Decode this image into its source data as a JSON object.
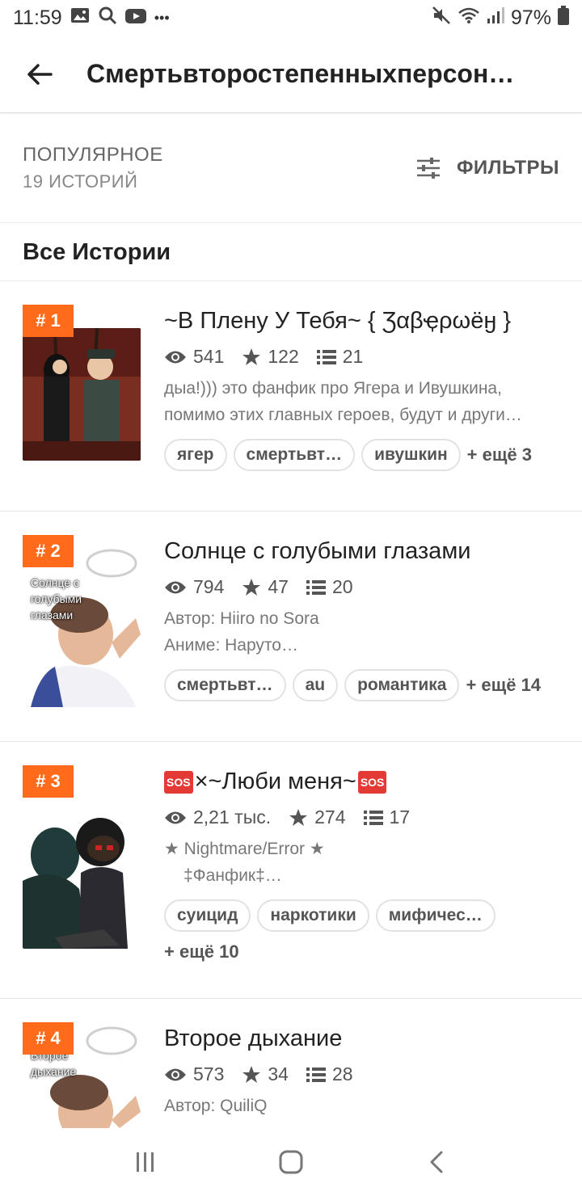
{
  "status_bar": {
    "time": "11:59",
    "overflow": "•••",
    "battery": "97%"
  },
  "header": {
    "title": "Смертьвторостепенныхперсон…"
  },
  "filter": {
    "sort": "ПОПУЛЯРНОЕ",
    "count": "19 ИСТОРИЙ",
    "filters_label": "ФИЛЬТРЫ"
  },
  "section": {
    "title": "Все Истории"
  },
  "stories": [
    {
      "rank": "# 1",
      "title": "~В Плену У Тебя~ { Ʒαβҿρωёӈ }",
      "views": "541",
      "votes": "122",
      "parts": "21",
      "desc1": "дыа!))) это фанфик про Ягера и Ивушкина,",
      "desc2": "помимо этих главных героев, будут и други…",
      "tags": [
        "ягер",
        "смертьвт…",
        "ивушкин"
      ],
      "more": "+ ещё 3"
    },
    {
      "rank": "# 2",
      "title": "Солнце с голубыми глазами",
      "cover_text": "Солнце с голубыми глазами",
      "views": "794",
      "votes": "47",
      "parts": "20",
      "desc1": "Автор: Hiiro no Sora",
      "desc2": "Аниме: Наруто…",
      "tags": [
        "смертьвт…",
        "au",
        "романтика"
      ],
      "more": "+ ещё 14"
    },
    {
      "rank": "# 3",
      "title_prefix_icon": "SOS",
      "title": "×~Люби меня~",
      "title_suffix_icon": "SOS",
      "views": "2,21 тыс.",
      "votes": "274",
      "parts": "17",
      "desc1": "★ Nightmare/Error ★",
      "desc2": "‡Фанфик‡…",
      "tags": [
        "суицид",
        "наркотики",
        "мифичес…"
      ],
      "more": "+ ещё 10"
    },
    {
      "rank": "# 4",
      "title": "Второе дыхание",
      "cover_text": "Второе дыхание",
      "views": "573",
      "votes": "34",
      "parts": "28",
      "desc1": "Автор: QuiliQ"
    }
  ],
  "colors": {
    "accent": "#ff6b1a",
    "text": "#222222",
    "muted": "#777777"
  }
}
